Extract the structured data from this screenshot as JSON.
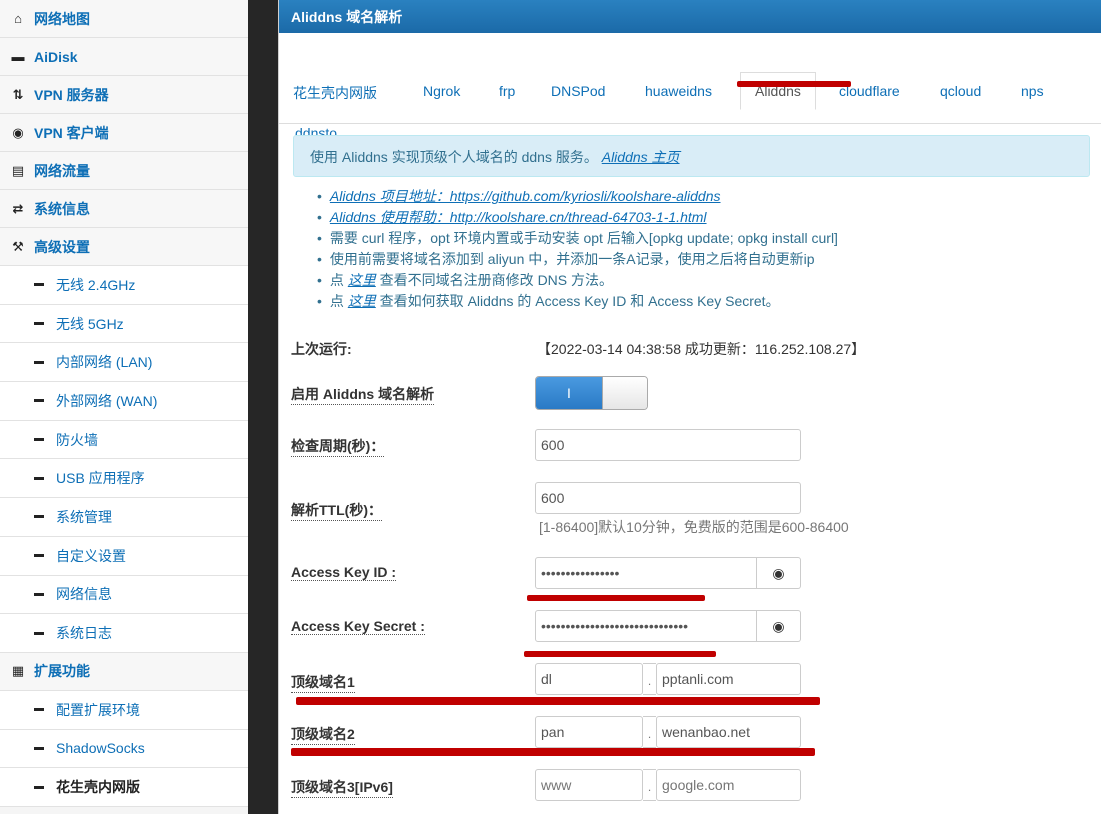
{
  "sidebar": {
    "items": [
      {
        "label": "网络地图",
        "icon": "home-icon"
      },
      {
        "label": "AiDisk",
        "icon": "disk-icon"
      },
      {
        "label": "VPN 服务器",
        "icon": "vpn-server-icon"
      },
      {
        "label": "VPN 客户端",
        "icon": "globe-icon"
      },
      {
        "label": "网络流量",
        "icon": "traffic-icon"
      },
      {
        "label": "系统信息",
        "icon": "shuffle-icon"
      },
      {
        "label": "高级设置",
        "icon": "wrench-icon"
      }
    ],
    "advanced_subitems": [
      "无线 2.4GHz",
      "无线 5GHz",
      "内部网络 (LAN)",
      "外部网络 (WAN)",
      "防火墙",
      "USB 应用程序",
      "系统管理",
      "自定义设置",
      "网络信息",
      "系统日志"
    ],
    "ext_item": {
      "label": "扩展功能",
      "icon": "grid-icon"
    },
    "ext_subitems": [
      "配置扩展环境",
      "ShadowSocks",
      "花生壳内网版"
    ]
  },
  "page": {
    "title": "Aliddns 域名解析"
  },
  "tabs": [
    "花生壳内网版",
    "Ngrok",
    "frp",
    "DNSPod",
    "huaweidns",
    "Aliddns",
    "cloudflare",
    "qcloud",
    "nps",
    "ddnsto"
  ],
  "info": {
    "text": "使用 Aliddns 实现顶级个人域名的 ddns 服务。",
    "link": "Aliddns 主页"
  },
  "bullets": {
    "b1": "Aliddns 项目地址：https://github.com/kyriosli/koolshare-aliddns",
    "b2": "Aliddns 使用帮助：http://koolshare.cn/thread-64703-1-1.html",
    "b3": "需要 curl 程序，opt 环境内置或手动安装 opt 后输入[opkg update; opkg install curl]",
    "b4": "使用前需要将域名添加到 aliyun 中，并添加一条A记录，使用之后将自动更新ip",
    "b5_pre": "点 ",
    "b5_link": "这里",
    "b5_post": " 查看不同域名注册商修改 DNS 方法。",
    "b6_pre": "点 ",
    "b6_link": "这里",
    "b6_post": " 查看如何获取 Aliddns 的 Access Key ID 和 Access Key Secret。"
  },
  "form": {
    "last_run_label": "上次运行:",
    "last_run_value": "【2022-03-14 04:38:58 成功更新：116.252.108.27】",
    "enable_label": "启用 Aliddns 域名解析",
    "toggle_on": "I",
    "interval_label": "检查周期(秒)：",
    "interval_value": "600",
    "ttl_label": "解析TTL(秒)：",
    "ttl_value": "600",
    "ttl_hint": "[1-86400]默认10分钟，免费版的范围是600-86400",
    "keyid_label": "Access Key ID :",
    "keyid_value": "••••••••••••••••",
    "secret_label": "Access Key Secret :",
    "secret_value": "••••••••••••••••••••••••••••••",
    "eye_icon": "eye-icon",
    "domain1_label": "顶级域名1",
    "domain1_host": "dl",
    "domain1_domain": "pptanli.com",
    "domain2_label": "顶级域名2",
    "domain2_host": "pan",
    "domain2_domain": "wenanbao.net",
    "domain3_label": "顶级域名3[IPv6]",
    "domain3_host_ph": "www",
    "domain3_domain_ph": "google.com",
    "dot": "."
  },
  "colors": {
    "accent": "#1b6aa8",
    "link": "#0e6fb6",
    "redaction": "#c00000",
    "info_bg": "#d9edf7"
  }
}
